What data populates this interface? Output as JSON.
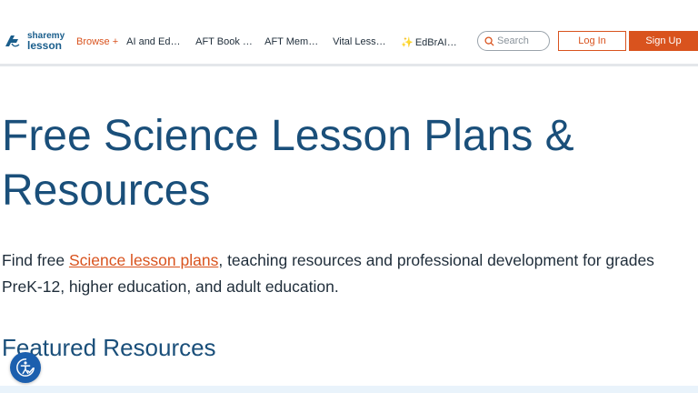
{
  "header": {
    "logo": {
      "line1": "sharemy",
      "line2": "lesson",
      "mark": "AFT"
    },
    "nav": {
      "browse_label": "Browse",
      "browse_icon": "plus-icon",
      "items": [
        "AI and Educ...",
        "AFT Book Cl...",
        "AFT Membe...",
        "Vital Lesso...",
        "EdBrAIn I..."
      ],
      "sparkle_icon": "sparkle-icon"
    },
    "search": {
      "placeholder": "Search",
      "icon": "search-icon"
    },
    "login_label": "Log In",
    "signup_label": "Sign Up"
  },
  "main": {
    "title": "Free Science Lesson Plans & Resources",
    "intro_prefix": "Find free ",
    "intro_link": "Science lesson plans",
    "intro_suffix": ", teaching resources and professional development for grades PreK-12, higher education, and adult education.",
    "featured_heading": "Featured Resources"
  },
  "accessibility_button": {
    "icon": "accessibility-icon"
  },
  "colors": {
    "accent": "#d9531e",
    "heading": "#1a4f7a",
    "a11y": "#1c5fae"
  }
}
